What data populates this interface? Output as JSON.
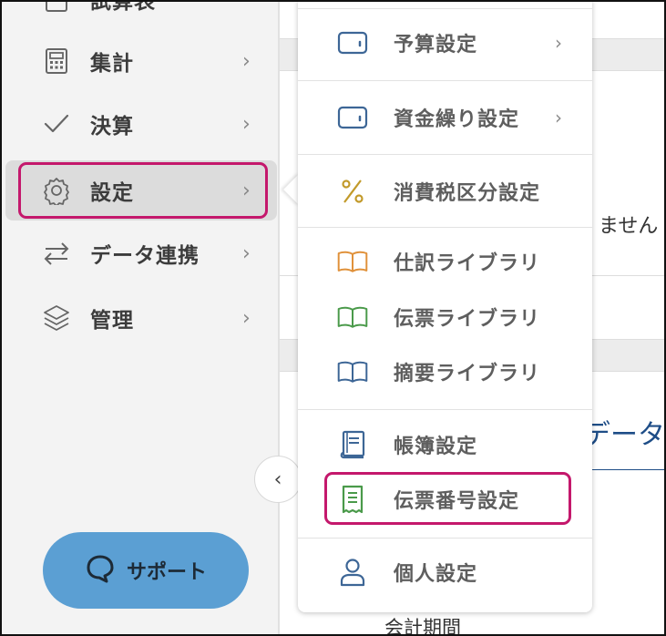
{
  "sidebar": {
    "items": [
      {
        "label": "試算表",
        "icon": "document-icon"
      },
      {
        "label": "集計",
        "icon": "calculator-icon"
      },
      {
        "label": "決算",
        "icon": "check-icon"
      },
      {
        "label": "設定",
        "icon": "gear-icon"
      },
      {
        "label": "データ連携",
        "icon": "sync-arrows-icon"
      },
      {
        "label": "管理",
        "icon": "layers-icon"
      }
    ],
    "chevron": "›",
    "collapse": "‹",
    "support_label": "サポート",
    "active_bg": "#dcdcdc",
    "highlight_color": "#c4186c"
  },
  "flyout": {
    "items": [
      {
        "label": "予算設定",
        "icon": "wallet-icon",
        "has_submenu": true
      },
      {
        "label": "資金繰り設定",
        "icon": "wallet-icon",
        "has_submenu": true
      },
      {
        "label": "消費税区分設定",
        "icon": "percent-icon",
        "has_submenu": false
      },
      {
        "label": "仕訳ライブラリ",
        "icon": "book-orange-icon",
        "has_submenu": false
      },
      {
        "label": "伝票ライブラリ",
        "icon": "book-green-icon",
        "has_submenu": false
      },
      {
        "label": "摘要ライブラリ",
        "icon": "book-blue-icon",
        "has_submenu": false
      },
      {
        "label": "帳簿設定",
        "icon": "ledger-icon",
        "has_submenu": false
      },
      {
        "label": "伝票番号設定",
        "icon": "receipt-icon",
        "has_submenu": false
      },
      {
        "label": "個人設定",
        "icon": "user-icon",
        "has_submenu": false
      }
    ],
    "chevron": "›"
  },
  "main": {
    "text_1": "ません",
    "text_2": "データ",
    "text_3": "会計期間"
  },
  "colors": {
    "support_button": "#5b9fd3",
    "accent_blue": "#1e4d87",
    "icon_orange": "#e0913a",
    "icon_green": "#4a9a4a",
    "icon_blue": "#3d6696",
    "icon_gold": "#c29a2a"
  }
}
